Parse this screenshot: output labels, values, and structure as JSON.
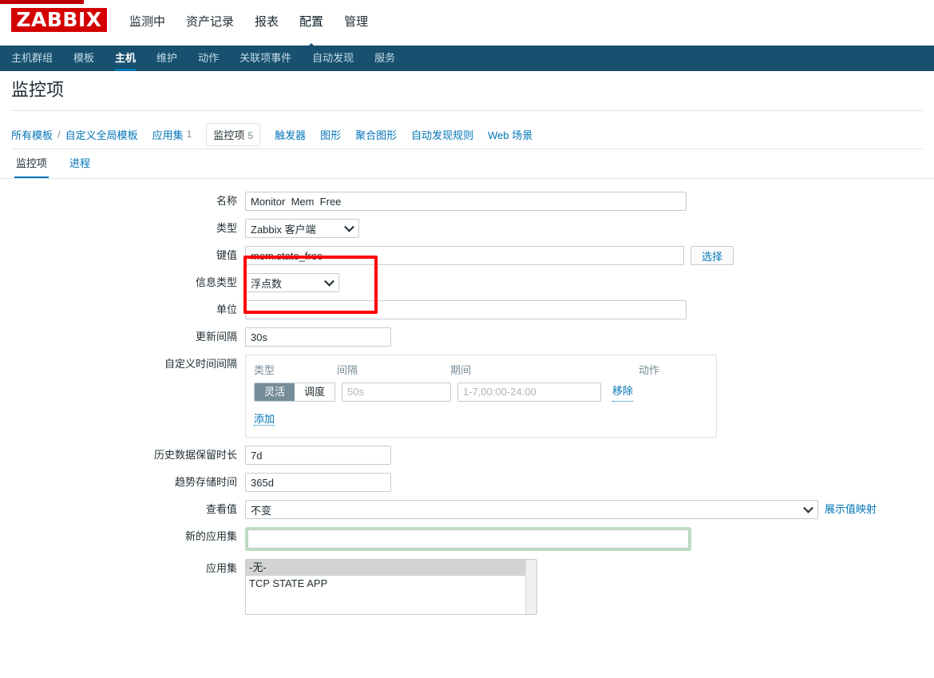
{
  "brand": {
    "logo_text": "ZABBIX",
    "logo_color": "#d40000"
  },
  "top_menu": {
    "items": [
      {
        "label": "监测中",
        "active": false
      },
      {
        "label": "资产记录",
        "active": false
      },
      {
        "label": "报表",
        "active": false
      },
      {
        "label": "配置",
        "active": true
      },
      {
        "label": "管理",
        "active": false
      }
    ]
  },
  "sub_nav": {
    "items": [
      {
        "label": "主机群组",
        "active": false
      },
      {
        "label": "模板",
        "active": false
      },
      {
        "label": "主机",
        "active": true
      },
      {
        "label": "维护",
        "active": false
      },
      {
        "label": "动作",
        "active": false
      },
      {
        "label": "关联项事件",
        "active": false
      },
      {
        "label": "自动发现",
        "active": false
      },
      {
        "label": "服务",
        "active": false
      }
    ]
  },
  "page": {
    "title": "监控项"
  },
  "breadcrumb": {
    "root": "所有模板",
    "separator": "/",
    "template": "自定义全局模板",
    "items": [
      {
        "label": "应用集",
        "count": "1",
        "current": false
      },
      {
        "label": "监控项",
        "count": "5",
        "current": true
      },
      {
        "label": "触发器",
        "count": "",
        "current": false
      },
      {
        "label": "图形",
        "count": "",
        "current": false
      },
      {
        "label": "聚合图形",
        "count": "",
        "current": false
      },
      {
        "label": "自动发现规则",
        "count": "",
        "current": false
      },
      {
        "label": "Web 场景",
        "count": "",
        "current": false
      }
    ]
  },
  "form_tabs": {
    "items": [
      {
        "label": "监控项",
        "active": true
      },
      {
        "label": "进程",
        "active": false
      }
    ]
  },
  "form": {
    "name": {
      "label": "名称",
      "value": "Monitor  Mem  Free"
    },
    "type": {
      "label": "类型",
      "value": "Zabbix 客户端"
    },
    "key": {
      "label": "键值",
      "value": "mem.state_free",
      "select_button": "选择"
    },
    "info_type": {
      "label": "信息类型",
      "value": "浮点数"
    },
    "units": {
      "label": "单位",
      "value": "",
      "placeholder": ""
    },
    "update_interval": {
      "label": "更新间隔",
      "value": "30s"
    },
    "custom_intervals": {
      "label": "自定义时间间隔",
      "headers": {
        "type": "类型",
        "interval": "间隔",
        "period": "期间",
        "action": "动作"
      },
      "rows": [
        {
          "mode_flexible": "灵活",
          "mode_scheduling": "调度",
          "mode_active": "灵活",
          "interval_placeholder": "50s",
          "interval_value": "",
          "period_placeholder": "1-7,00:00-24:00",
          "period_value": "",
          "remove_label": "移除"
        }
      ],
      "add_label": "添加"
    },
    "history": {
      "label": "历史数据保留时长",
      "value": "7d"
    },
    "trends": {
      "label": "趋势存储时间",
      "value": "365d"
    },
    "view_value": {
      "label": "查看值",
      "value": "不变",
      "link": "展示值映射"
    },
    "new_application": {
      "label": "新的应用集",
      "value": "",
      "placeholder": ""
    },
    "applications": {
      "label": "应用集",
      "options": [
        {
          "label": "-无-",
          "selected": true
        },
        {
          "label": "TCP STATE APP",
          "selected": false
        }
      ]
    }
  },
  "annotations": {
    "red_box": {
      "color": "#ff0000",
      "targets": "键值 + 信息类型"
    }
  }
}
